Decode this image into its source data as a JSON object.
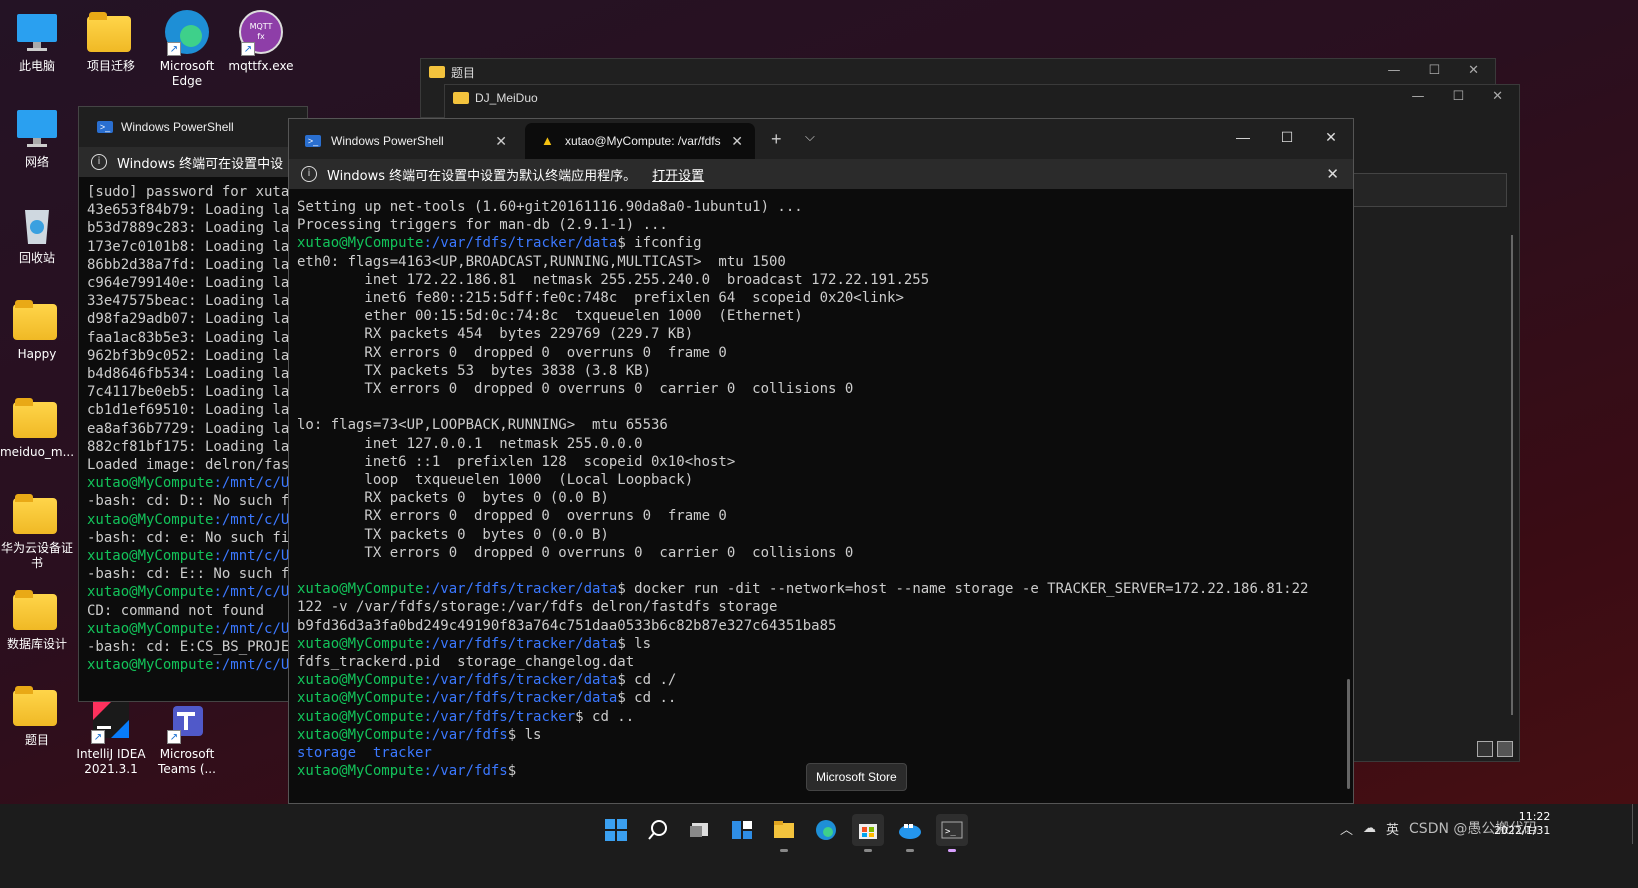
{
  "desktop_icons": [
    {
      "label": "此电脑",
      "icon": "computer-icon"
    },
    {
      "label": "项目迁移",
      "icon": "folder-icon"
    },
    {
      "label": "Microsoft\nEdge",
      "icon": "edge-icon"
    },
    {
      "label": "mqttfx.exe",
      "icon": "mqttfx-icon",
      "badge": "MQTT fx"
    },
    {
      "label": "网络",
      "icon": "network-icon"
    },
    {
      "label": "回收站",
      "icon": "recycle-bin-icon"
    },
    {
      "label": "Happy",
      "icon": "folder-icon"
    },
    {
      "label": "meiduo_m...",
      "icon": "folder-icon"
    },
    {
      "label": "华为云设备证\n书",
      "icon": "folder-icon"
    },
    {
      "label": "数据库设计",
      "icon": "folder-icon"
    },
    {
      "label": "题目",
      "icon": "folder-icon"
    },
    {
      "label": "IntelliJ IDEA\n2021.3.1",
      "icon": "intellij-icon"
    },
    {
      "label": "Microsoft\nTeams (...",
      "icon": "teams-icon"
    }
  ],
  "explorer1": {
    "title": "题目"
  },
  "explorer2": {
    "title": "DJ_MeiDuo"
  },
  "ps_left": {
    "tab": "Windows PowerShell",
    "info": "Windows 终端可在设置中设",
    "lines": [
      "[sudo] password for xuta",
      "43e653f84b79: Loading la",
      "b53d7889c283: Loading la",
      "173e7c0101b8: Loading la",
      "86bb2d38a7fd: Loading la",
      "c964e799140e: Loading la",
      "33e47575beac: Loading la",
      "d98fa29adb07: Loading la",
      "faa1ac83b5e3: Loading la",
      "962bf3b9c052: Loading la",
      "b4d8646fb534: Loading la",
      "7c4117be0eb5: Loading la",
      "cb1d1ef69510: Loading la",
      "ea8af36b7729: Loading la",
      "882cf81bf175: Loading la",
      "Loaded image: delron/fas"
    ],
    "tail": [
      {
        "p": "xutao@MyCompute",
        "d": ":/mnt/c/U",
        "t": ""
      },
      {
        "t": "-bash: cd: D:: No such f"
      },
      {
        "p": "xutao@MyCompute",
        "d": ":/mnt/c/U",
        "t": ""
      },
      {
        "t": "-bash: cd: e: No such fi"
      },
      {
        "p": "xutao@MyCompute",
        "d": ":/mnt/c/U",
        "t": ""
      },
      {
        "t": "-bash: cd: E:: No such f"
      },
      {
        "p": "xutao@MyCompute",
        "d": ":/mnt/c/U",
        "t": ""
      },
      {
        "t": "CD: command not found"
      },
      {
        "p": "xutao@MyCompute",
        "d": ":/mnt/c/U",
        "t": ""
      },
      {
        "t": "-bash: cd: E:CS_BS_PROJE"
      },
      {
        "p": "xutao@MyCompute",
        "d": ":/mnt/c/U",
        "t": ""
      }
    ]
  },
  "terminal": {
    "tab1": "Windows PowerShell",
    "tab2": "xutao@MyCompute: /var/fdfs",
    "new_tab": "+",
    "dropdown": "⌵",
    "info": "Windows 终端可在设置中设置为默认终端应用程序。",
    "info_link": "打开设置",
    "lines": [
      {
        "t": "Setting up net-tools (1.60+git20161116.90da8a0-1ubuntu1) ..."
      },
      {
        "t": "Processing triggers for man-db (2.9.1-1) ..."
      },
      {
        "p": "xutao@MyCompute",
        "d": ":/var/fdfs/tracker/data",
        "t": "$ ifconfig"
      },
      {
        "t": "eth0: flags=4163<UP,BROADCAST,RUNNING,MULTICAST>  mtu 1500"
      },
      {
        "t": "        inet 172.22.186.81  netmask 255.255.240.0  broadcast 172.22.191.255"
      },
      {
        "t": "        inet6 fe80::215:5dff:fe0c:748c  prefixlen 64  scopeid 0x20<link>"
      },
      {
        "t": "        ether 00:15:5d:0c:74:8c  txqueuelen 1000  (Ethernet)"
      },
      {
        "t": "        RX packets 454  bytes 229769 (229.7 KB)"
      },
      {
        "t": "        RX errors 0  dropped 0  overruns 0  frame 0"
      },
      {
        "t": "        TX packets 53  bytes 3838 (3.8 KB)"
      },
      {
        "t": "        TX errors 0  dropped 0 overruns 0  carrier 0  collisions 0"
      },
      {
        "t": ""
      },
      {
        "t": "lo: flags=73<UP,LOOPBACK,RUNNING>  mtu 65536"
      },
      {
        "t": "        inet 127.0.0.1  netmask 255.0.0.0"
      },
      {
        "t": "        inet6 ::1  prefixlen 128  scopeid 0x10<host>"
      },
      {
        "t": "        loop  txqueuelen 1000  (Local Loopback)"
      },
      {
        "t": "        RX packets 0  bytes 0 (0.0 B)"
      },
      {
        "t": "        RX errors 0  dropped 0  overruns 0  frame 0"
      },
      {
        "t": "        TX packets 0  bytes 0 (0.0 B)"
      },
      {
        "t": "        TX errors 0  dropped 0 overruns 0  carrier 0  collisions 0"
      },
      {
        "t": ""
      },
      {
        "p": "xutao@MyCompute",
        "d": ":/var/fdfs/tracker/data",
        "t": "$ docker run -dit --network=host --name storage -e TRACKER_SERVER=172.22.186.81:22"
      },
      {
        "t": "122 -v /var/fdfs/storage:/var/fdfs delron/fastdfs storage"
      },
      {
        "t": "b9fd36d3a3fa0bd249c49190f83a764c751daa0533b6c82b87e327c64351ba85"
      },
      {
        "p": "xutao@MyCompute",
        "d": ":/var/fdfs/tracker/data",
        "t": "$ ls"
      },
      {
        "t": "fdfs_trackerd.pid  storage_changelog.dat"
      },
      {
        "p": "xutao@MyCompute",
        "d": ":/var/fdfs/tracker/data",
        "t": "$ cd ./"
      },
      {
        "p": "xutao@MyCompute",
        "d": ":/var/fdfs/tracker/data",
        "t": "$ cd .."
      },
      {
        "p": "xutao@MyCompute",
        "d": ":/var/fdfs/tracker",
        "t": "$ cd .."
      },
      {
        "p": "xutao@MyCompute",
        "d": ":/var/fdfs",
        "t": "$ ls"
      },
      {
        "blue": "storage  tracker"
      },
      {
        "p": "xutao@MyCompute",
        "d": ":/var/fdfs",
        "t": "$"
      }
    ]
  },
  "tooltip": "Microsoft Store",
  "taskbar": {
    "icons": [
      "start-icon",
      "search-icon",
      "task-view-icon",
      "widgets-icon",
      "file-explorer-icon",
      "edge-icon",
      "microsoft-store-icon",
      "docker-icon",
      "terminal-icon"
    ],
    "tray_text": "英",
    "watermark": "CSDN @愚公搬代码",
    "time": "11:22",
    "date": "2022/1/31"
  }
}
